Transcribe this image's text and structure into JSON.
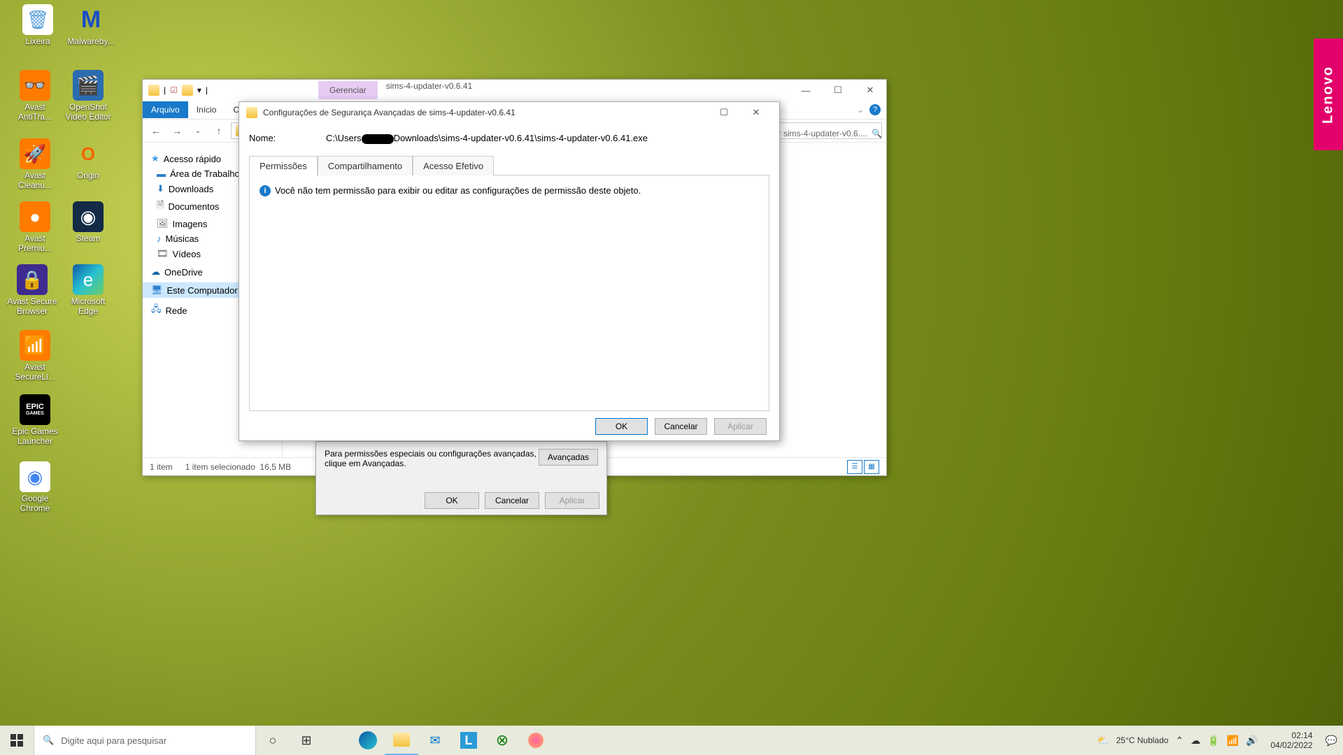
{
  "desktop": {
    "icons": [
      {
        "label": "Lixeira",
        "bg": "#fff",
        "glyph": "🗑"
      },
      {
        "label": "Malwareby...",
        "bg": "#1a4ec8",
        "glyph": "M"
      },
      {
        "label": "Avast AntiTra...",
        "bg": "#ff7b00",
        "glyph": "👓"
      },
      {
        "label": "OpenShot Video Editor",
        "bg": "#2b6cb0",
        "glyph": "🎬"
      },
      {
        "label": "Avast Cleanu...",
        "bg": "#ff7b00",
        "glyph": "🚀"
      },
      {
        "label": "Origin",
        "bg": "#f56400",
        "glyph": "O"
      },
      {
        "label": "Avast Premiu...",
        "bg": "#ff7b00",
        "glyph": "●"
      },
      {
        "label": "Steam",
        "bg": "#132b47",
        "glyph": "◉"
      },
      {
        "label": "Avast Secure Browser",
        "bg": "#3d2b8f",
        "glyph": "🔒"
      },
      {
        "label": "Microsoft Edge",
        "bg": "#0d9e8a",
        "glyph": "e"
      },
      {
        "label": "Avast SecureLi...",
        "bg": "#ff7b00",
        "glyph": "📶"
      },
      {
        "label": "Epic Games Launcher",
        "bg": "#000",
        "glyph": "E"
      },
      {
        "label": "Google Chrome",
        "bg": "#fff",
        "glyph": "◉"
      }
    ]
  },
  "lenovo": "Lenovo",
  "explorer": {
    "manage_tab": "Gerenciar",
    "title": "sims-4-updater-v0.6.41",
    "ribbon": {
      "arquivo": "Arquivo",
      "inicio": "Início",
      "comp": "Comp"
    },
    "search_hint": "r sims-4-updater-v0.6....",
    "sidebar": {
      "quick": "Acesso rápido",
      "desktop": "Área de Trabalho",
      "downloads": "Downloads",
      "documents": "Documentos",
      "images": "Imagens",
      "music": "Músicas",
      "videos": "Vídeos",
      "onedrive": "OneDrive",
      "thispc": "Este Computador",
      "network": "Rede"
    },
    "status": {
      "count": "1 item",
      "sel": "1 item selecionado",
      "size": "16,5 MB"
    }
  },
  "props": {
    "text1": "Para permissões especiais ou configurações avançadas,",
    "text2": "clique em Avançadas.",
    "advanced_btn": "Avançadas",
    "ok": "OK",
    "cancel": "Cancelar",
    "apply": "Aplicar"
  },
  "adv": {
    "title": "Configurações de Segurança Avançadas de sims-4-updater-v0.6.41",
    "name_label": "Nome:",
    "path_a": "C:\\Users",
    "path_b": "Downloads\\sims-4-updater-v0.6.41\\sims-4-updater-v0.6.41.exe",
    "tabs": {
      "perm": "Permissões",
      "share": "Compartilhamento",
      "eff": "Acesso Efetivo"
    },
    "notice": "Você não tem permissão para exibir ou editar as configurações de permissão deste objeto.",
    "ok": "OK",
    "cancel": "Cancelar",
    "apply": "Aplicar"
  },
  "taskbar": {
    "search_placeholder": "Digite aqui para pesquisar",
    "weather": "25°C  Nublado",
    "time": "02:14",
    "date": "04/02/2022"
  }
}
